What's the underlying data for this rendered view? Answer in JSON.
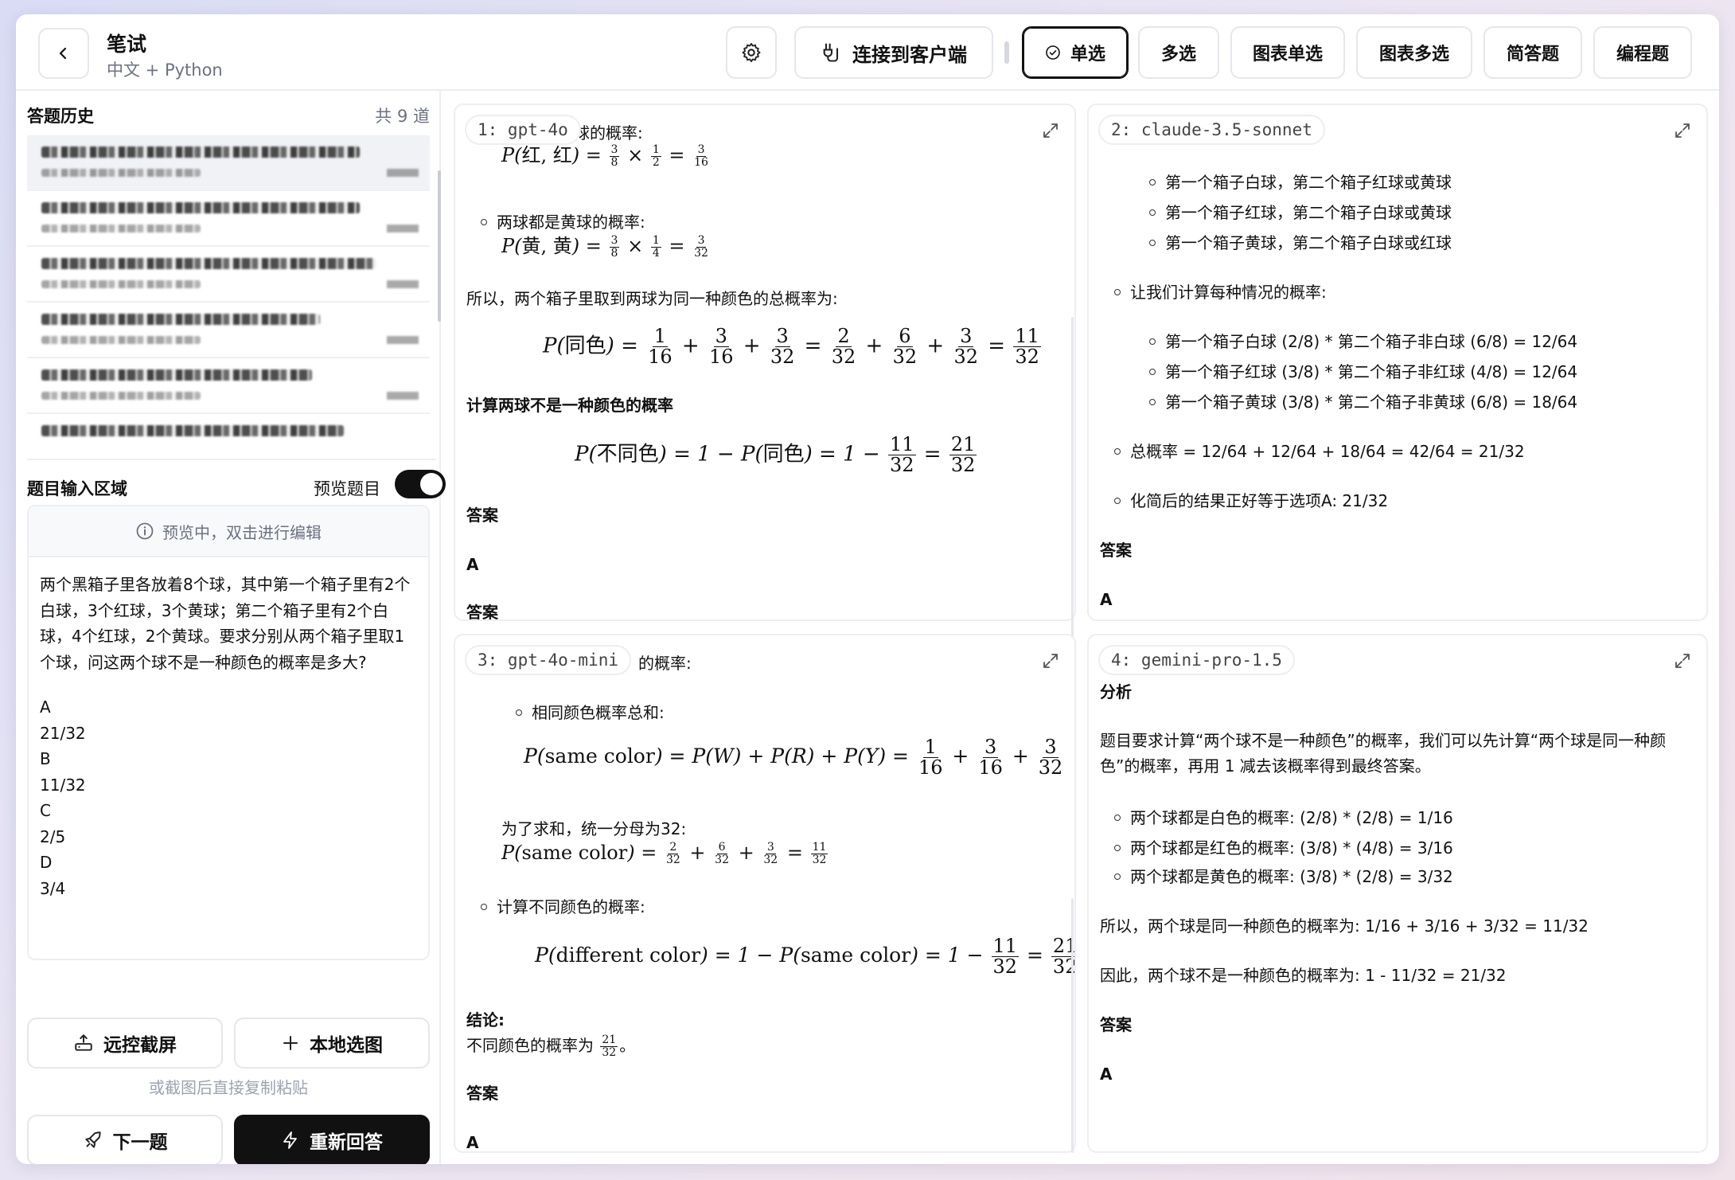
{
  "header": {
    "title": "笔试",
    "subtitle": "中文 + Python",
    "connect_label": "连接到客户端",
    "tabs": [
      "单选",
      "多选",
      "图表单选",
      "图表多选",
      "简答题",
      "编程题"
    ]
  },
  "history": {
    "title": "答题历史",
    "count": "共 9 道"
  },
  "input_area": {
    "title": "题目输入区域",
    "preview_label": "预览题目",
    "preview_on": true,
    "hint": "预览中，双击进行编辑",
    "question": "两个黑箱子里各放着8个球，其中第一个箱子里有2个白球，3个红球，3个黄球；第二个箱子里有2个白球，4个红球，2个黄球。要求分别从两个箱子里取1个球，问这两个球不是一种颜色的概率是多大?",
    "options": [
      "A",
      "21/32",
      "B",
      "11/32",
      "C",
      "2/5",
      "D",
      "3/4"
    ]
  },
  "actions": {
    "screenshot": "远控截屏",
    "local_pick": "本地选图",
    "paste_hint": "或截图后直接复制粘贴",
    "next": "下一题",
    "rerun": "重新回答"
  },
  "panels": {
    "p1": {
      "tag": "1: gpt-4o",
      "l1": "球的概率:",
      "l2": "两球都是黄球的概率:",
      "l3": "所以，两个箱子里取到两球为同一种颜色的总概率为:",
      "h1": "计算两球不是一种颜色的概率",
      "ans1": "答案",
      "ansv": "A",
      "ans2": "答案"
    },
    "p2": {
      "tag": "2: claude-3.5-sonnet",
      "b1": "第一个箱子白球，第二个箱子红球或黄球",
      "b2": "第一个箱子红球，第二个箱子白球或黄球",
      "b3": "第一个箱子黄球，第二个箱子白球或红球",
      "c1": "让我们计算每种情况的概率:",
      "d1": "第一个箱子白球 (2/8) * 第二个箱子非白球 (6/8) = 12/64",
      "d2": "第一个箱子红球 (3/8) * 第二个箱子非红球 (4/8) = 12/64",
      "d3": "第一个箱子黄球 (3/8) * 第二个箱子非黄球 (6/8) = 18/64",
      "t1": "总概率 = 12/64 + 12/64 + 18/64 = 42/64 = 21/32",
      "t2": "化简后的结果正好等于选项A: 21/32",
      "ans": "答案",
      "ansv": "A"
    },
    "p3": {
      "tag": "3: gpt-4o-mini",
      "l1": "的概率:",
      "b1": "相同颜色概率总和:",
      "l2": "为了求和，统一分母为32:",
      "b2": "计算不同颜色的概率:",
      "conc": "结论:",
      "concl": "不同颜色的概率为",
      "ans": "答案",
      "ansv": "A"
    },
    "p4": {
      "tag": "4: gemini-pro-1.5",
      "h": "分析",
      "intro": "题目要求计算“两个球不是一种颜色”的概率，我们可以先计算“两个球是同一种颜色”的概率，再用 1 减去该概率得到最终答案。",
      "b1": "两个球都是白色的概率:  (2/8) * (2/8) = 1/16",
      "b2": "两个球都是红色的概率:  (3/8) * (4/8) = 3/16",
      "b3": "两个球都是黄色的概率:  (3/8) * (2/8) = 3/32",
      "s1": "所以，两个球是同一种颜色的概率为:  1/16 + 3/16 + 3/32 = 11/32",
      "s2": "因此，两个球不是一种颜色的概率为:  1 - 11/32 = 21/32",
      "ans": "答案",
      "ansv": "A"
    }
  }
}
